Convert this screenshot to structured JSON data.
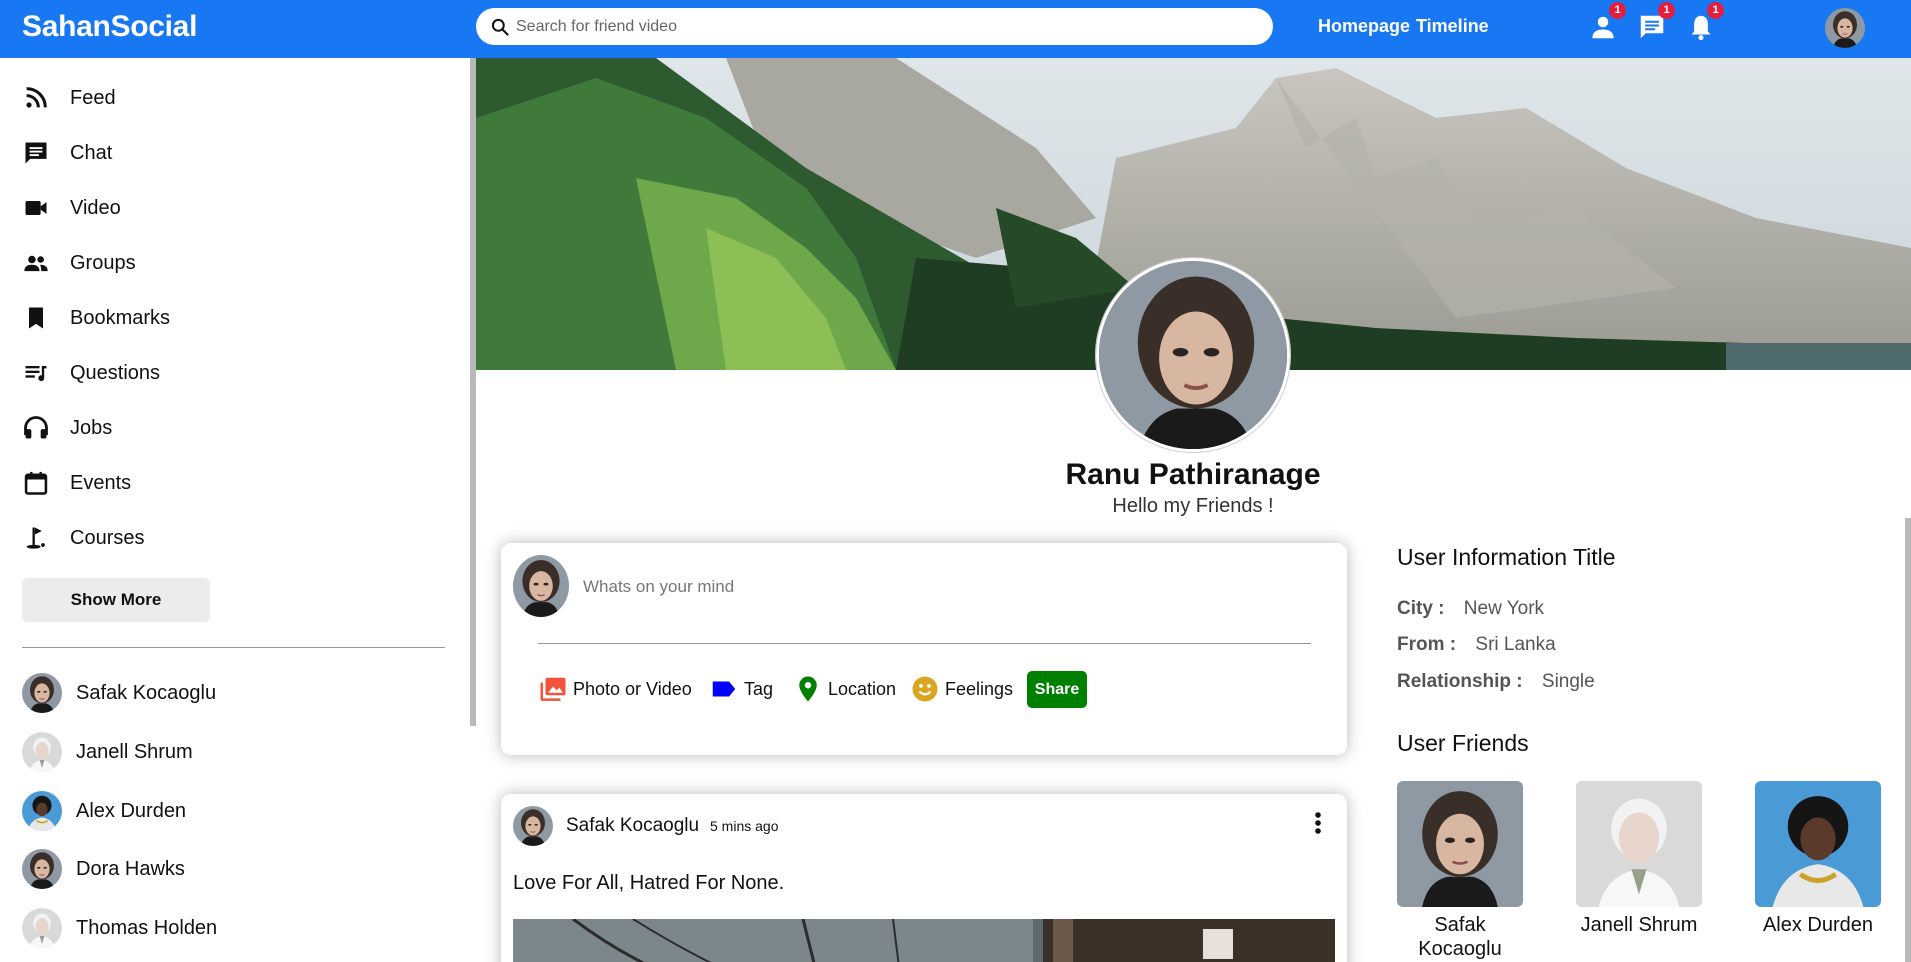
{
  "app": {
    "title": "SahanSocial"
  },
  "search": {
    "placeholder": "Search for friend video"
  },
  "nav": {
    "links": [
      "Homepage",
      "Timeline"
    ],
    "icons": [
      {
        "name": "friend-requests-icon",
        "badge": "1"
      },
      {
        "name": "messages-icon",
        "badge": "1"
      },
      {
        "name": "notifications-icon",
        "badge": "1"
      }
    ]
  },
  "sidebar": {
    "items": [
      {
        "label": "Feed",
        "icon": "rss-feed-icon"
      },
      {
        "label": "Chat",
        "icon": "chat-icon"
      },
      {
        "label": "Video",
        "icon": "video-camera-icon"
      },
      {
        "label": "Groups",
        "icon": "groups-icon"
      },
      {
        "label": "Bookmarks",
        "icon": "bookmark-icon"
      },
      {
        "label": "Questions",
        "icon": "playlist-icon"
      },
      {
        "label": "Jobs",
        "icon": "headphones-icon"
      },
      {
        "label": "Events",
        "icon": "calendar-icon"
      },
      {
        "label": "Courses",
        "icon": "golf-course-icon"
      }
    ],
    "show_more_label": "Show More",
    "friends": [
      "Safak Kocaoglu",
      "Janell Shrum",
      "Alex Durden",
      "Dora Hawks",
      "Thomas Holden"
    ]
  },
  "profile": {
    "name": "Ranu Pathiranage",
    "status": "Hello my Friends !"
  },
  "share": {
    "placeholder": "Whats on your mind",
    "options": [
      "Photo or Video",
      "Tag",
      "Location",
      "Feelings"
    ],
    "share_label": "Share"
  },
  "post": {
    "author": "Safak Kocaoglu",
    "time": "5 mins ago",
    "text": "Love For All, Hatred For None."
  },
  "user_info": {
    "title": "User Information Title",
    "rows": [
      {
        "key": "City :",
        "value": "New York"
      },
      {
        "key": "From :",
        "value": "Sri Lanka"
      },
      {
        "key": "Relationship :",
        "value": "Single"
      }
    ]
  },
  "user_friends": {
    "title": "User Friends",
    "items": [
      "Safak Kocaoglu",
      "Janell Shrum",
      "Alex Durden"
    ]
  },
  "colors": {
    "primary": "#1877f2",
    "share_button": "#008000",
    "badge": "#e41e3f"
  }
}
